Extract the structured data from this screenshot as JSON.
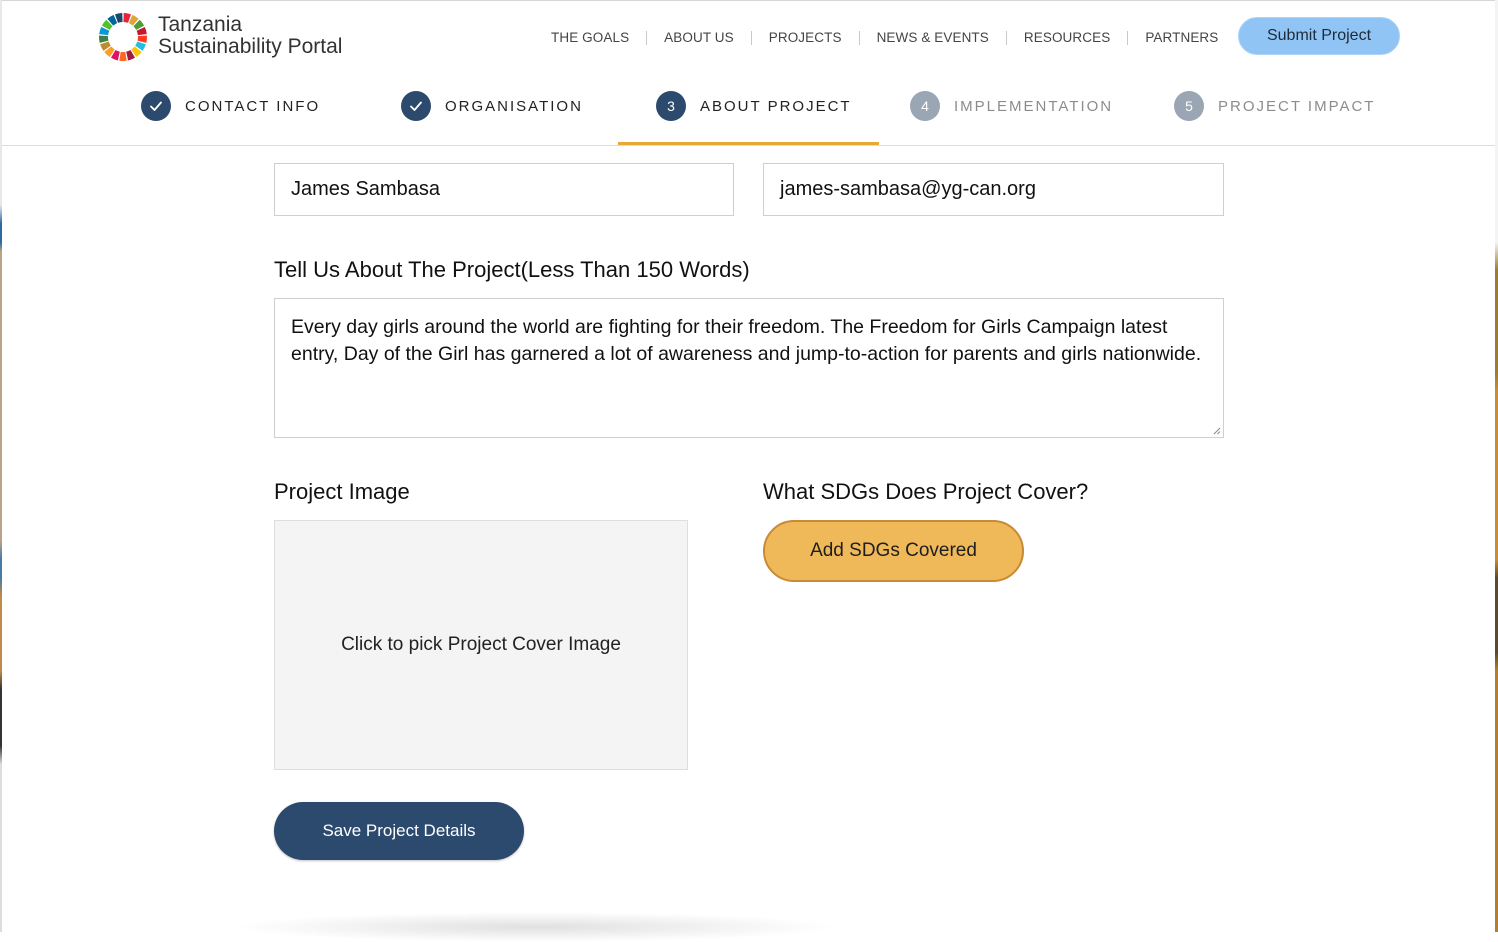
{
  "brand": {
    "line1": "Tanzania",
    "line2": "Sustainability Portal"
  },
  "nav": {
    "items": [
      "THE GOALS",
      "ABOUT US",
      "PROJECTS",
      "NEWS & EVENTS",
      "RESOURCES",
      "PARTNERS"
    ],
    "submit_label": "Submit Project"
  },
  "steps": [
    {
      "marker": "check",
      "label": "CONTACT INFO",
      "state": "done"
    },
    {
      "marker": "check",
      "label": "ORGANISATION",
      "state": "done"
    },
    {
      "marker": "3",
      "label": "ABOUT PROJECT",
      "state": "active"
    },
    {
      "marker": "4",
      "label": "IMPLEMENTATION",
      "state": "pending"
    },
    {
      "marker": "5",
      "label": "PROJECT IMPACT",
      "state": "pending"
    }
  ],
  "form": {
    "name_value": "James Sambasa",
    "email_value": "james-sambasa@yg-can.org",
    "about_label": "Tell Us About The Project(Less Than 150 Words)",
    "about_value": "Every day girls around the world are fighting for their freedom. The Freedom for Girls Campaign latest entry, Day of the Girl has garnered a lot of awareness and jump-to-action for parents and girls nationwide.",
    "image_label": "Project Image",
    "image_placeholder": "Click to pick Project Cover Image",
    "sdg_label": "What SDGs Does Project Cover?",
    "sdg_button": "Add SDGs Covered",
    "save_button": "Save Project Details"
  },
  "colors": {
    "primary": "#2c4a6e",
    "accent": "#e9a734",
    "submit_bg": "#90c4f5",
    "sdg_button_bg": "#efb95a",
    "pending_step": "#9aa6b4"
  },
  "icons": {
    "logo": "sdg-wheel-icon",
    "done_marker": "check-icon"
  }
}
